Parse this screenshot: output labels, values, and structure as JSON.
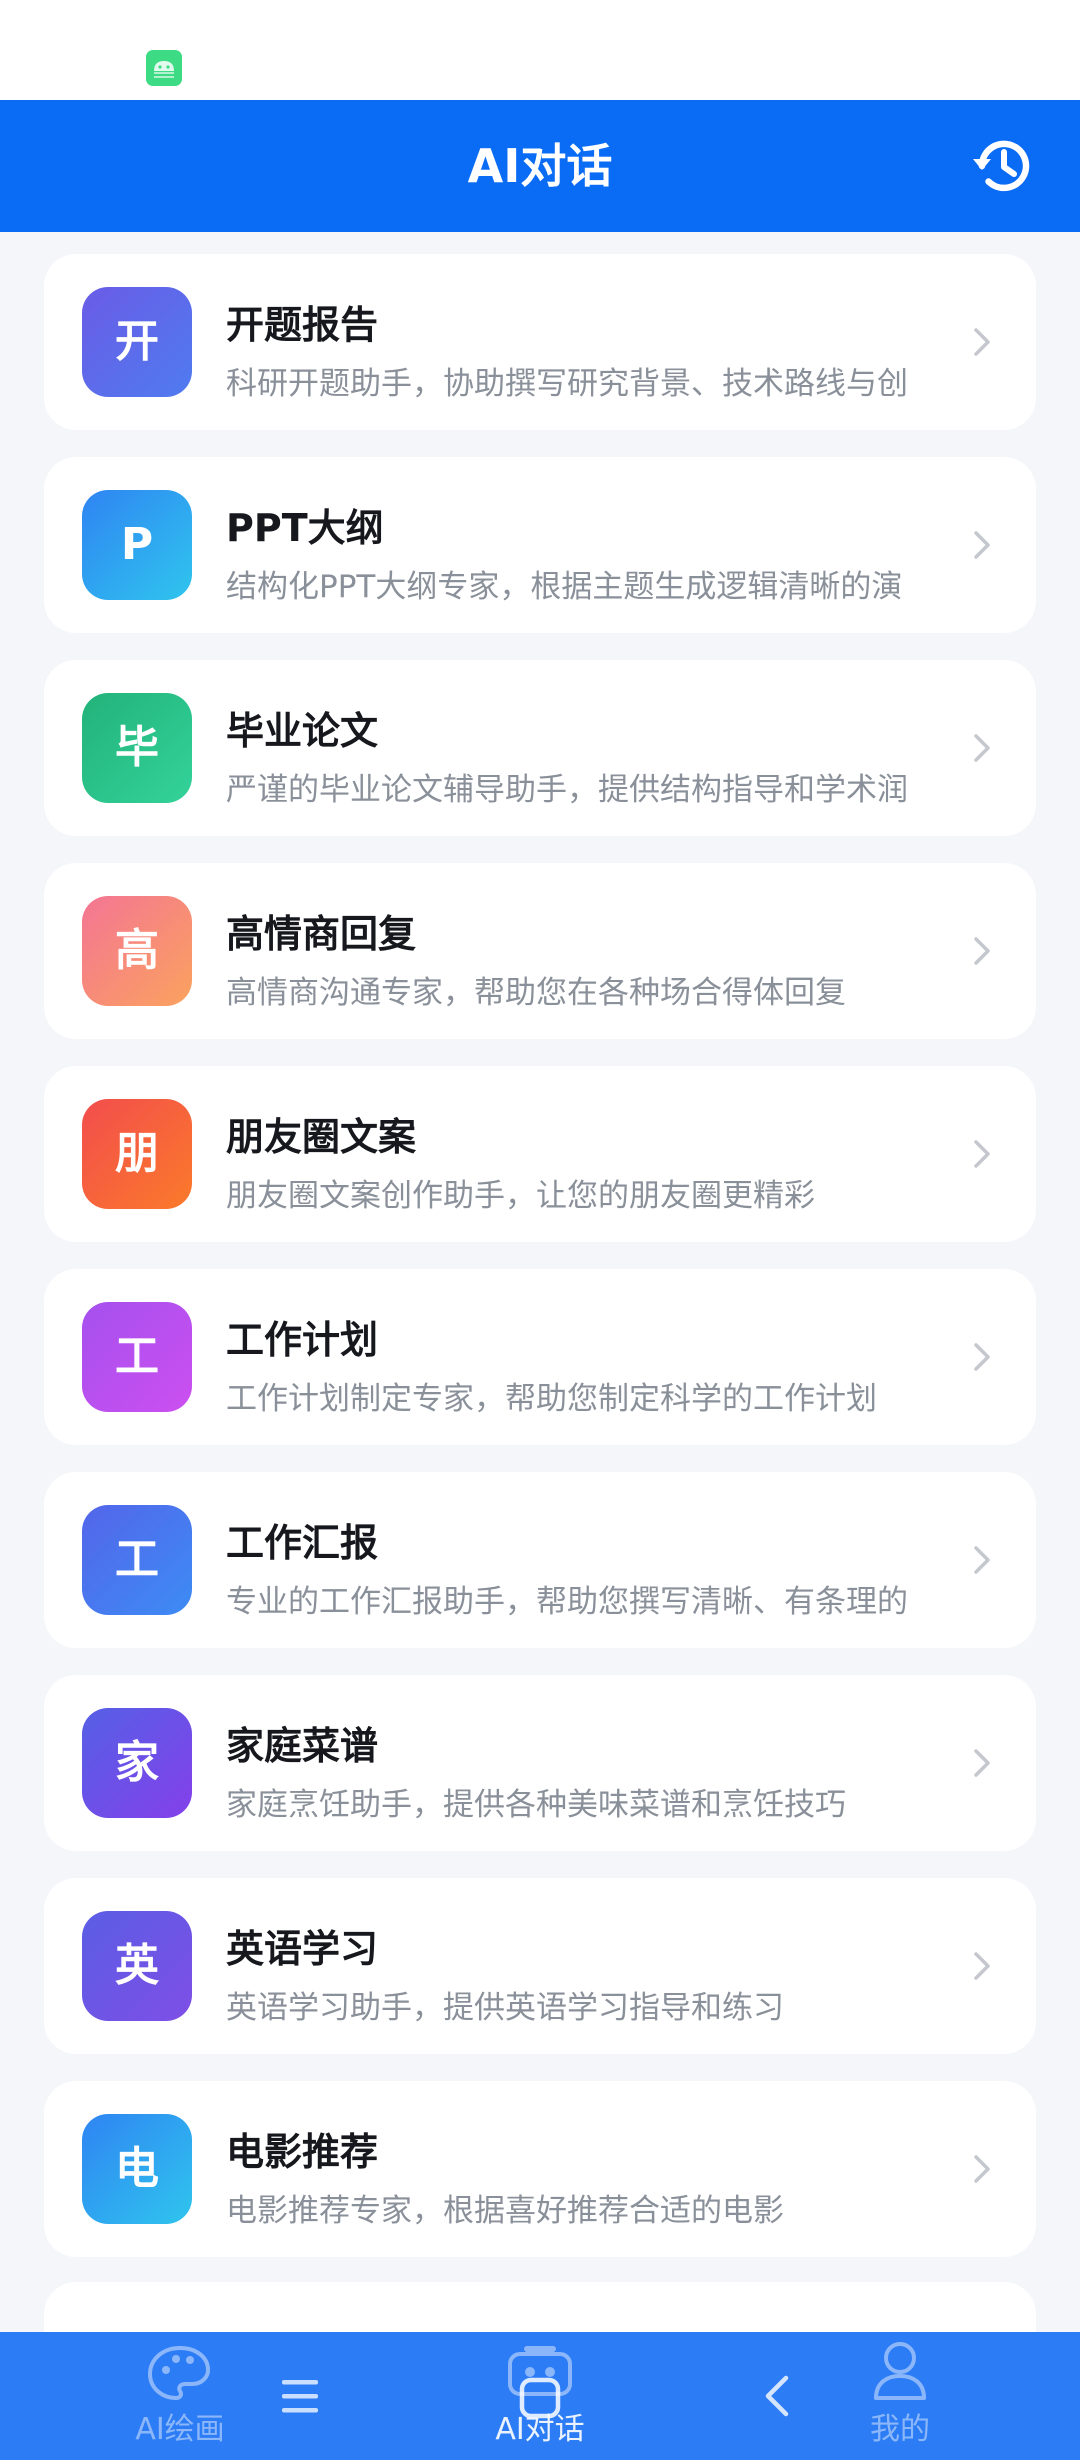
{
  "header": {
    "title": "AI对话"
  },
  "items": [
    {
      "icon_char": "开",
      "title": "开题报告",
      "desc": "科研开题助手，协助撰写研究背景、技术路线与创",
      "color1": "#6a5ce6",
      "color2": "#4f7bf0"
    },
    {
      "icon_char": "P",
      "title": "PPT大纲",
      "desc": "结构化PPT大纲专家，根据主题生成逻辑清晰的演",
      "color1": "#2f84f2",
      "color2": "#2fc5ee"
    },
    {
      "icon_char": "毕",
      "title": "毕业论文",
      "desc": "严谨的毕业论文辅导助手，提供结构指导和学术润",
      "color1": "#22b27a",
      "color2": "#33d39a"
    },
    {
      "icon_char": "高",
      "title": "高情商回复",
      "desc": "高情商沟通专家，帮助您在各种场合得体回复",
      "color1": "#f37594",
      "color2": "#fba25e"
    },
    {
      "icon_char": "朋",
      "title": "朋友圈文案",
      "desc": "朋友圈文案创作助手，让您的朋友圈更精彩",
      "color1": "#f24d4d",
      "color2": "#fb7a2a"
    },
    {
      "icon_char": "工",
      "title": "工作计划",
      "desc": "工作计划制定专家，帮助您制定科学的工作计划",
      "color1": "#a550ee",
      "color2": "#cc4ff0"
    },
    {
      "icon_char": "工",
      "title": "工作汇报",
      "desc": "专业的工作汇报助手，帮助您撰写清晰、有条理的",
      "color1": "#5365ea",
      "color2": "#3d8cf4"
    },
    {
      "icon_char": "家",
      "title": "家庭菜谱",
      "desc": "家庭烹饪助手，提供各种美味菜谱和烹饪技巧",
      "color1": "#5560e6",
      "color2": "#8440ea"
    },
    {
      "icon_char": "英",
      "title": "英语学习",
      "desc": "英语学习助手，提供英语学习指导和练习",
      "color1": "#5a5de4",
      "color2": "#7f4fe6"
    },
    {
      "icon_char": "电",
      "title": "电影推荐",
      "desc": "电影推荐专家，根据喜好推荐合适的电影",
      "color1": "#2f84f2",
      "color2": "#2fc5ee"
    }
  ],
  "tabs": {
    "draw": "AI绘画",
    "chat": "AI对话",
    "mine": "我的"
  },
  "colors": {
    "header": "#0a6cf5",
    "tabbar": "#2c7cf6",
    "background": "#f4f6f9"
  }
}
